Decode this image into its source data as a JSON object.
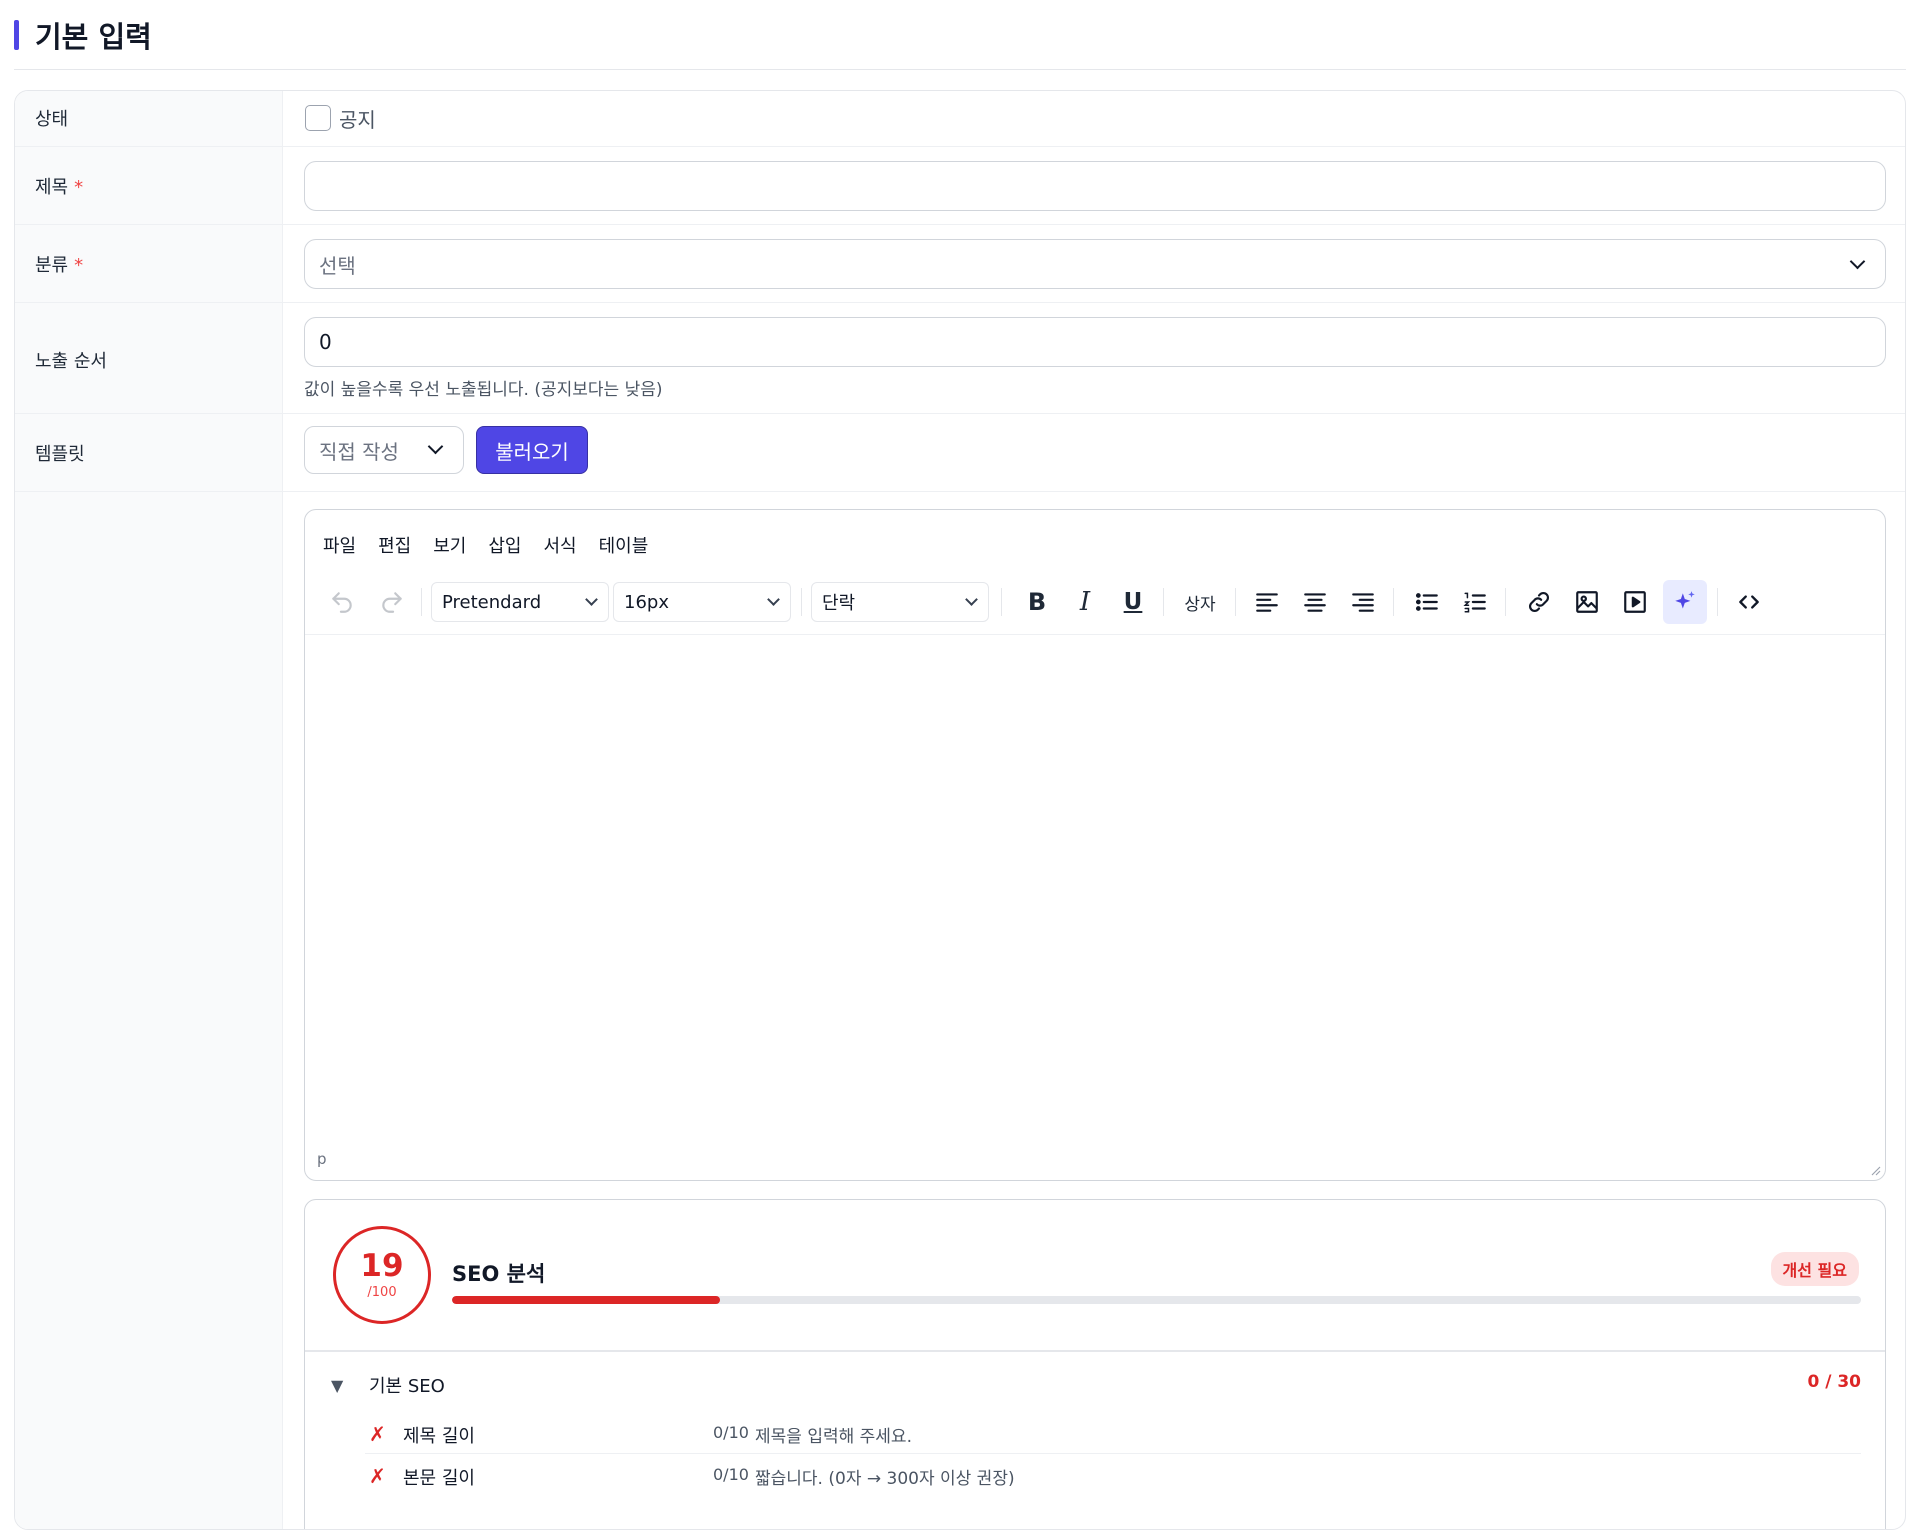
{
  "header": {
    "title": "기본 입력"
  },
  "colors": {
    "accent": "#4f46e5",
    "danger": "#dc2626",
    "required": "#ef4444"
  },
  "form": {
    "status": {
      "label": "상태",
      "checkbox_label": "공지",
      "checked": false
    },
    "title": {
      "label": "제목",
      "required_mark": "*",
      "value": ""
    },
    "category": {
      "label": "분류",
      "required_mark": "*",
      "placeholder": "선택"
    },
    "order": {
      "label": "노출 순서",
      "value": "0",
      "hint": "값이 높을수록 우선 노출됩니다. (공지보다는 낮음)"
    },
    "template": {
      "label": "템플릿",
      "select_value": "직접 작성",
      "load_button": "불러오기"
    }
  },
  "editor": {
    "menu": [
      "파일",
      "편집",
      "보기",
      "삽입",
      "서식",
      "테이블"
    ],
    "font_family": "Pretendard",
    "font_size": "16px",
    "block_format": "단락",
    "box_label": "상자",
    "status_path": "p",
    "icons": [
      "undo-icon",
      "redo-icon",
      "bold-icon",
      "italic-icon",
      "underline-icon",
      "align-left-icon",
      "align-center-icon",
      "align-right-icon",
      "bullet-list-icon",
      "numbered-list-icon",
      "link-icon",
      "image-icon",
      "media-icon",
      "ai-sparkle-icon",
      "code-icon"
    ]
  },
  "seo": {
    "score": "19",
    "score_max": "/100",
    "score_fraction": 0.19,
    "title": "SEO 분석",
    "badge": "개선 필요",
    "groups": [
      {
        "title": "기본 SEO",
        "score": "0 / 30",
        "items": [
          {
            "mark": "✗",
            "name": "제목 길이",
            "points": "0/10",
            "message": "제목을 입력해 주세요."
          },
          {
            "mark": "✗",
            "name": "본문 길이",
            "points": "0/10",
            "message": "짧습니다. (0자 → 300자 이상 권장)"
          }
        ]
      }
    ]
  }
}
